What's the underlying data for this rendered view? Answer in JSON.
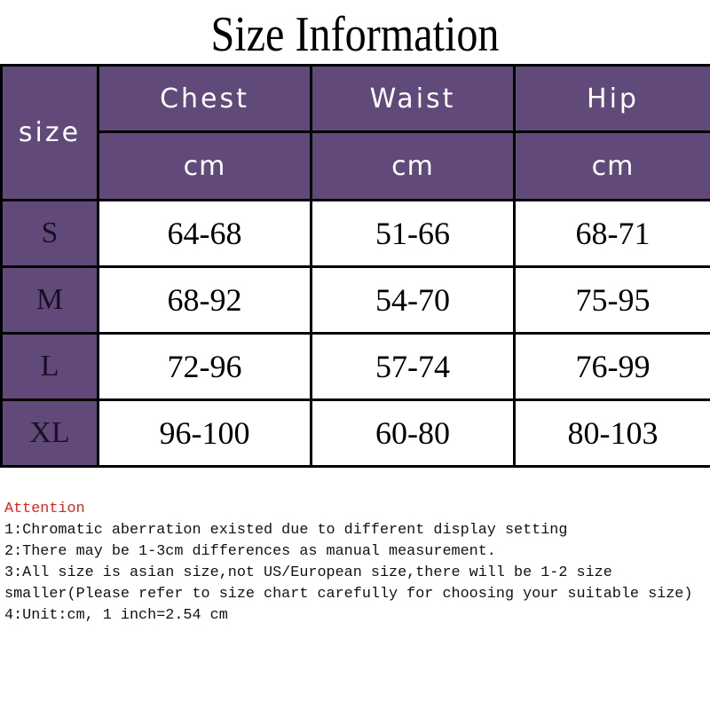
{
  "title": "Size Information",
  "table": {
    "size_header": "size",
    "columns": [
      {
        "label": "Chest",
        "unit": "cm"
      },
      {
        "label": "Waist",
        "unit": "cm"
      },
      {
        "label": "Hip",
        "unit": "cm"
      }
    ],
    "rows": [
      {
        "size": "S",
        "values": [
          "64-68",
          "51-66",
          "68-71"
        ]
      },
      {
        "size": "M",
        "values": [
          "68-92",
          "54-70",
          "75-95"
        ]
      },
      {
        "size": "L",
        "values": [
          "72-96",
          "57-74",
          "76-99"
        ]
      },
      {
        "size": "XL",
        "values": [
          "96-100",
          "60-80",
          "80-103"
        ]
      }
    ]
  },
  "notes": {
    "heading": "Attention",
    "lines": [
      "1:Chromatic aberration existed due to different display setting",
      "2:There may be 1-3cm differences as manual measurement.",
      "3:All size is asian size,not US/European size,there will be 1-2 size smaller(Please refer to size chart carefully for choosing your suitable size)",
      "4:Unit:cm, 1 inch=2.54 cm"
    ]
  },
  "colors": {
    "header_bg": "#614a7a",
    "header_text": "#ffffff",
    "attention": "#e8201a"
  }
}
